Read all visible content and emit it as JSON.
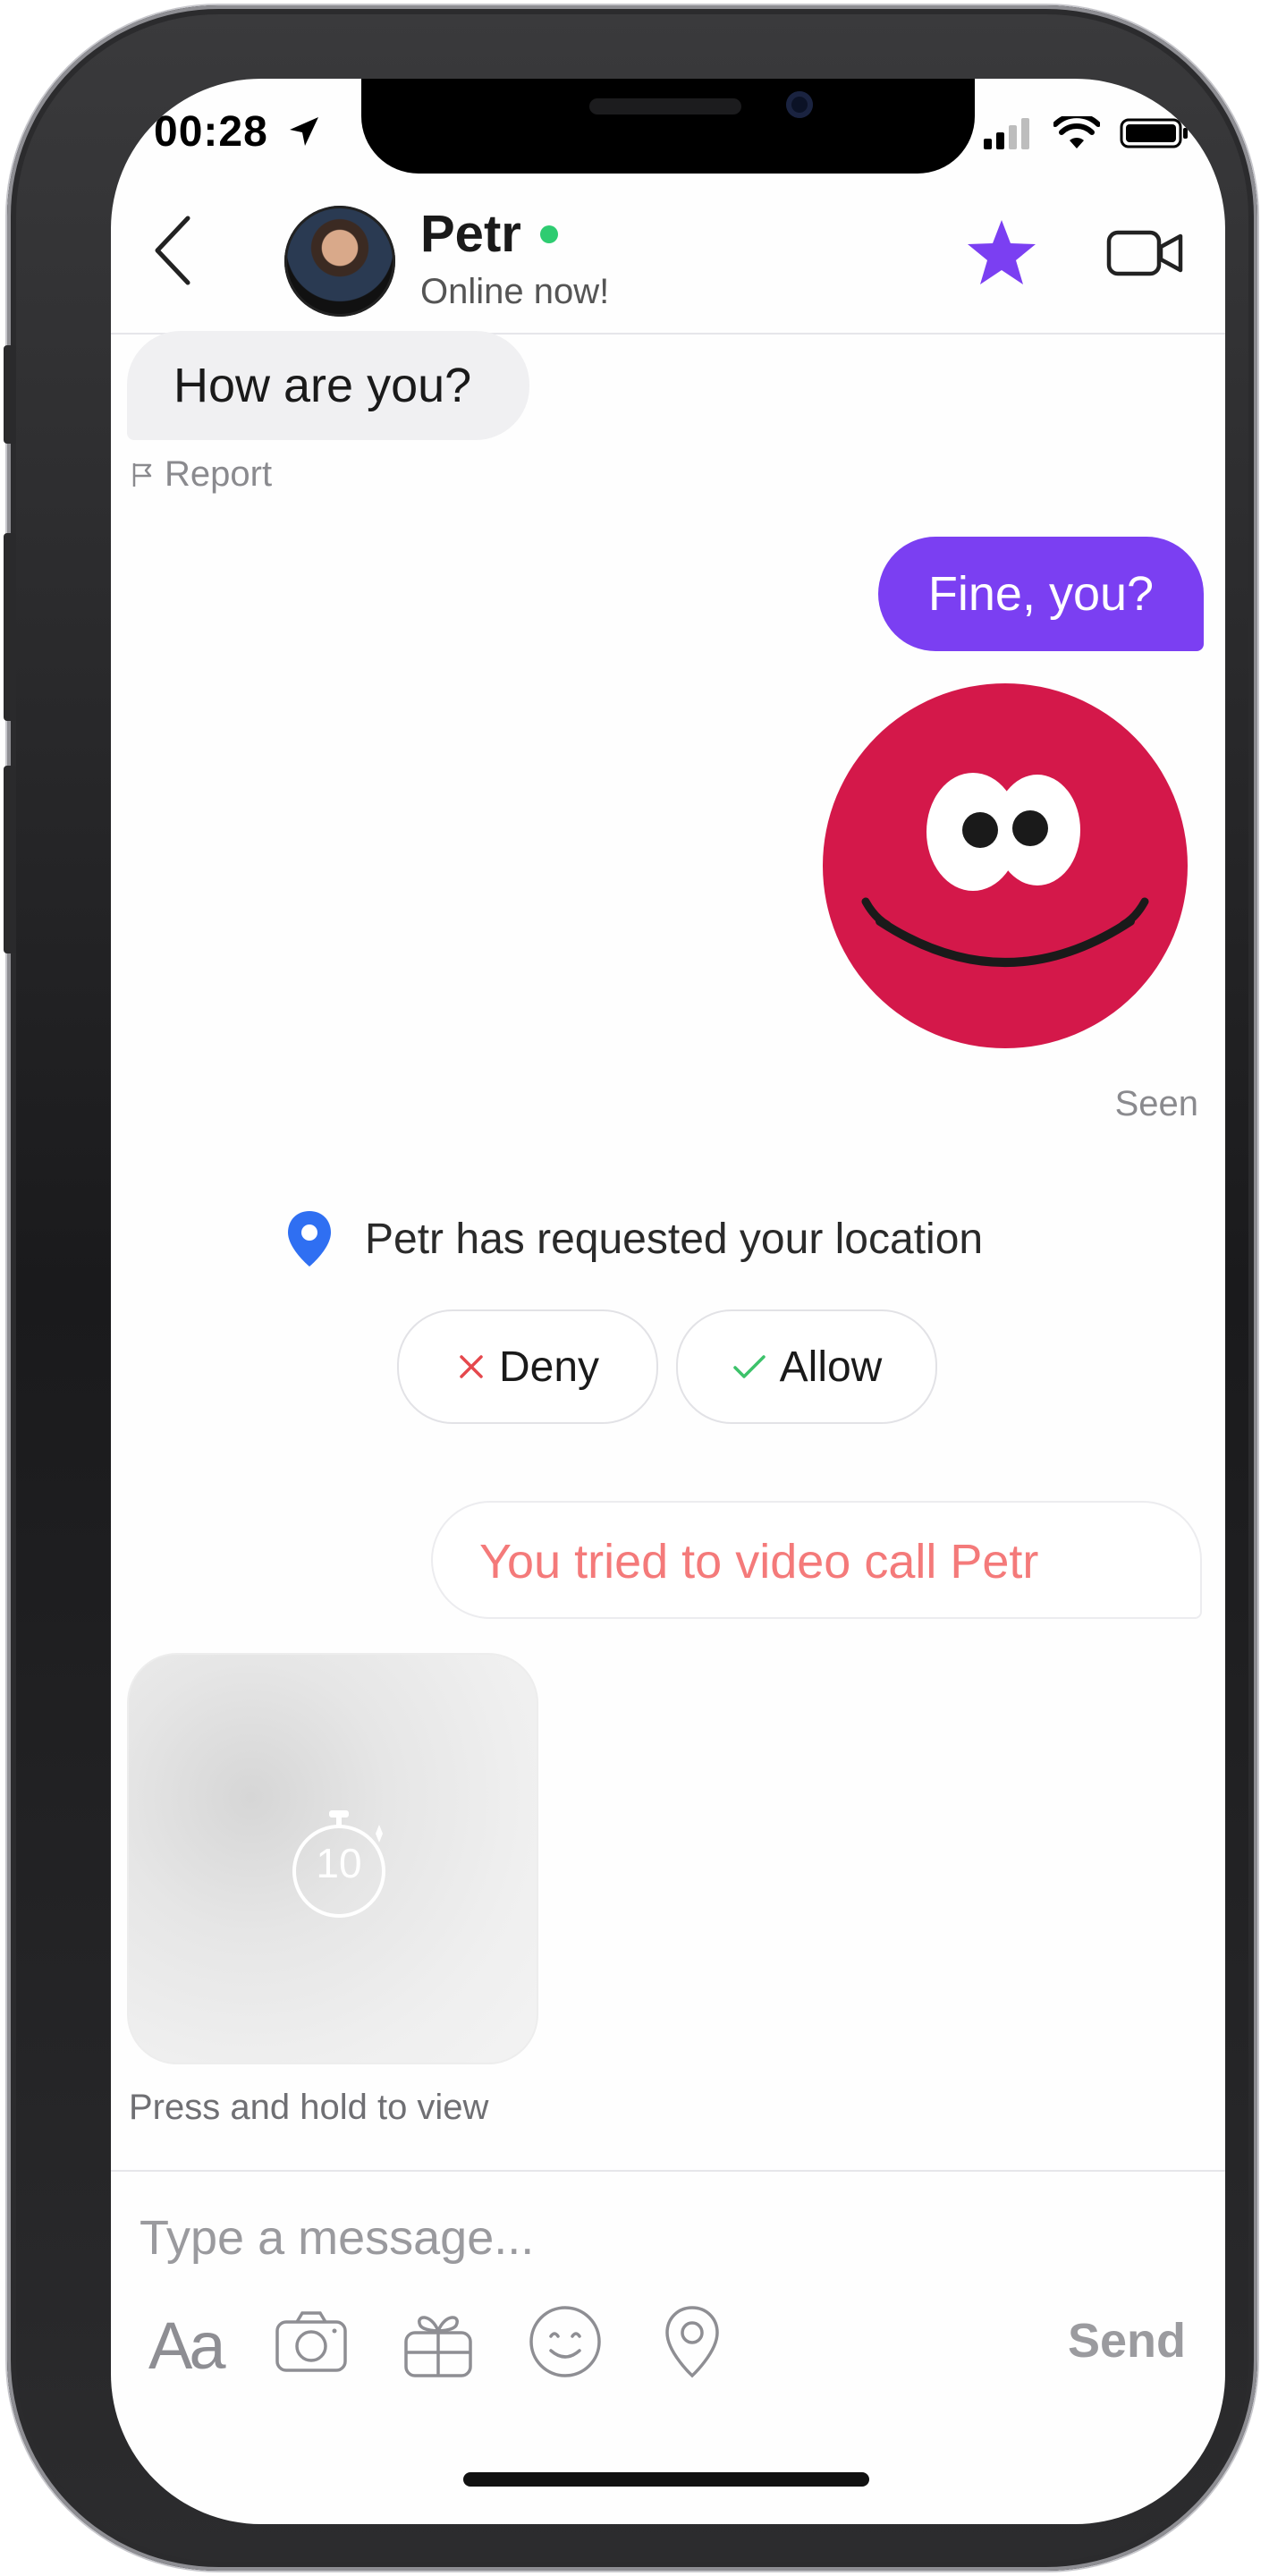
{
  "status_bar": {
    "time": "00:28"
  },
  "header": {
    "contact_name": "Petr",
    "contact_status": "Online now!",
    "online_color": "#2ecc71",
    "accent_color": "#7b3ff2",
    "icons": [
      "chevron-left-icon",
      "star-icon",
      "video-camera-icon"
    ]
  },
  "messages": {
    "incoming_1": "How are you?",
    "report_label": "Report",
    "outgoing_1": "Fine, you?",
    "sticker": "red-smiley-sticker",
    "seen_label": "Seen",
    "location_request": "Petr has requested your location",
    "deny_label": "Deny",
    "allow_label": "Allow",
    "video_call_notice": "You tried to video call Petr",
    "timed_media_seconds": "10",
    "timed_media_hint": "Press and hold to view"
  },
  "composer": {
    "placeholder": "Type a message...",
    "font_tool_label": "Aa",
    "send_label": "Send",
    "tools": [
      "text-style-icon",
      "camera-icon",
      "gift-icon",
      "emoji-icon",
      "location-pin-icon"
    ]
  }
}
